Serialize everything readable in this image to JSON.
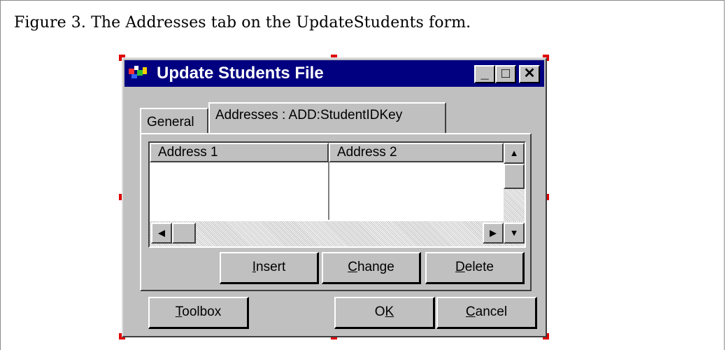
{
  "caption": "Figure 3. The Addresses tab on the UpdateStudents form.",
  "window": {
    "title": "Update Students File",
    "controls": {
      "minimize": "_",
      "maximize": "□",
      "close": "✕"
    }
  },
  "tabs": [
    {
      "label": "General",
      "active": false
    },
    {
      "label": "Addresses : ADD:StudentIDKey",
      "active": true
    }
  ],
  "list": {
    "columns": [
      "Address 1",
      "Address 2"
    ],
    "rows": []
  },
  "buttons": {
    "insert": {
      "accel": "I",
      "rest": "nsert"
    },
    "change": {
      "accel": "C",
      "rest": "hange"
    },
    "delete": {
      "accel": "D",
      "rest": "elete"
    },
    "toolbox": {
      "accel": "T",
      "rest": "oolbox"
    },
    "ok": {
      "pre": "O",
      "accel": "K",
      "rest": ""
    },
    "cancel": {
      "accel": "C",
      "rest": "ancel"
    }
  },
  "colors": {
    "titlebar": "#000080",
    "face": "#c0c0c0",
    "handle": "#e00000"
  },
  "icons": {
    "app": "app-icon",
    "scroll_up": "triangle-up",
    "scroll_down": "triangle-down",
    "scroll_left": "triangle-left",
    "scroll_right": "triangle-right"
  }
}
